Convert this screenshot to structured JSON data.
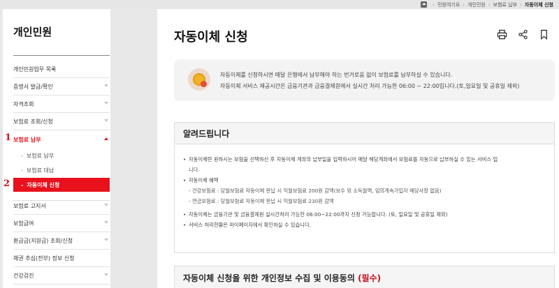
{
  "breadcrumb": [
    "민원여기요",
    "개인민원",
    "보험료 납부",
    "자동이체 신청"
  ],
  "sidebar": {
    "title": "개인민원",
    "items": [
      {
        "label": "개인민원업무 목록"
      },
      {
        "label": "증명서 발급/확인"
      },
      {
        "label": "자격조회"
      },
      {
        "label": "보험료 조회/신청"
      },
      {
        "label": "보험료 납부"
      },
      {
        "label": "보험료 고지서"
      },
      {
        "label": "보험급여"
      },
      {
        "label": "환급금(지원금) 조회/신청"
      },
      {
        "label": "채권 추심(전부) 정보 신청"
      },
      {
        "label": "건강검진"
      }
    ],
    "sub_items": [
      {
        "label": "보험료 납부"
      },
      {
        "label": "보험료 대납"
      },
      {
        "label": "자동이체 신청"
      }
    ]
  },
  "markers": [
    "1",
    "2"
  ],
  "main": {
    "title": "자동이체 신청",
    "info": [
      "자동이체를 신청하시면 매달 은행에서 납부해야 하는 번거로움 없이 보험료를 납부하실 수 있습니다.",
      "자동이체 서비스 제공시간은 금융기관과 금융결제원에서 실시간 처리 가능한 06:00 ~ 22:00입니다.(토,일요일 및 공휴일 제외)"
    ],
    "notice": {
      "title": "알려드립니다",
      "b1a": "자동이체란 원하시는 보험을 선택하신 후 자동이체 계좌의 납부일을 입력하시어 매달 해당계좌에서 보험료를 자동으로 납부하실 수 있는 서비스 입",
      "b1b": "니다.",
      "b2": "자동이체 혜택",
      "s1": "건강보험료 : 당월보험료 자동이체 완납 시 익월보험료 200원 감액(보수 외 소득월액, 임의계속가입자 해당사항 없음)",
      "s2": "연금보험료 : 당월보험료 자동이체 완납 시 익월보험료 230원 감액",
      "b3": "자동이체는 금융기관 및 금융결제원 실시간처리 가능한 06:00~22:00까지 신청 가능합니다. (토, 일요일 및 공휴일 제외)",
      "b4": "서비스 처리현황은 마이페이지에서 확인하실 수 있습니다."
    },
    "consent": {
      "title": "자동이체 신청을 위한 개인정보 수집 및 이용동의",
      "required": "(필수)"
    }
  },
  "icons": [
    "home-icon",
    "print-icon",
    "share-icon",
    "bookmark-icon",
    "coin-icon"
  ],
  "colors": {
    "accent": "#e8111c",
    "marker": "#d31414",
    "required": "#c0121b"
  }
}
